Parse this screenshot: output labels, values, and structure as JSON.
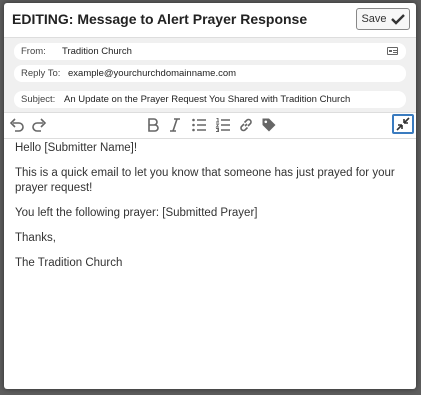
{
  "header": {
    "title": "EDITING: Message to Alert Prayer Response",
    "save_label": "Save"
  },
  "fields": {
    "from_label": "From:",
    "from_value": "Tradition Church",
    "reply_to_label": "Reply To:",
    "reply_to_value": "example@yourchurchdomainname.com",
    "subject_label": "Subject:",
    "subject_value": "An Update on the Prayer Request You Shared with Tradition Church"
  },
  "toolbar": {
    "icons": [
      "undo-icon",
      "redo-icon",
      "bold-icon",
      "italic-icon",
      "bulleted-list-icon",
      "numbered-list-icon",
      "link-icon",
      "tag-icon",
      "collapse-icon"
    ]
  },
  "body": {
    "greeting": "Hello [Submitter Name]!",
    "line1": "This is a quick email to let you know that someone has just prayed for your prayer request!",
    "line2": "You left the following prayer: [Submitted Prayer]",
    "closing": "Thanks,",
    "signature": "The Tradition Church"
  }
}
